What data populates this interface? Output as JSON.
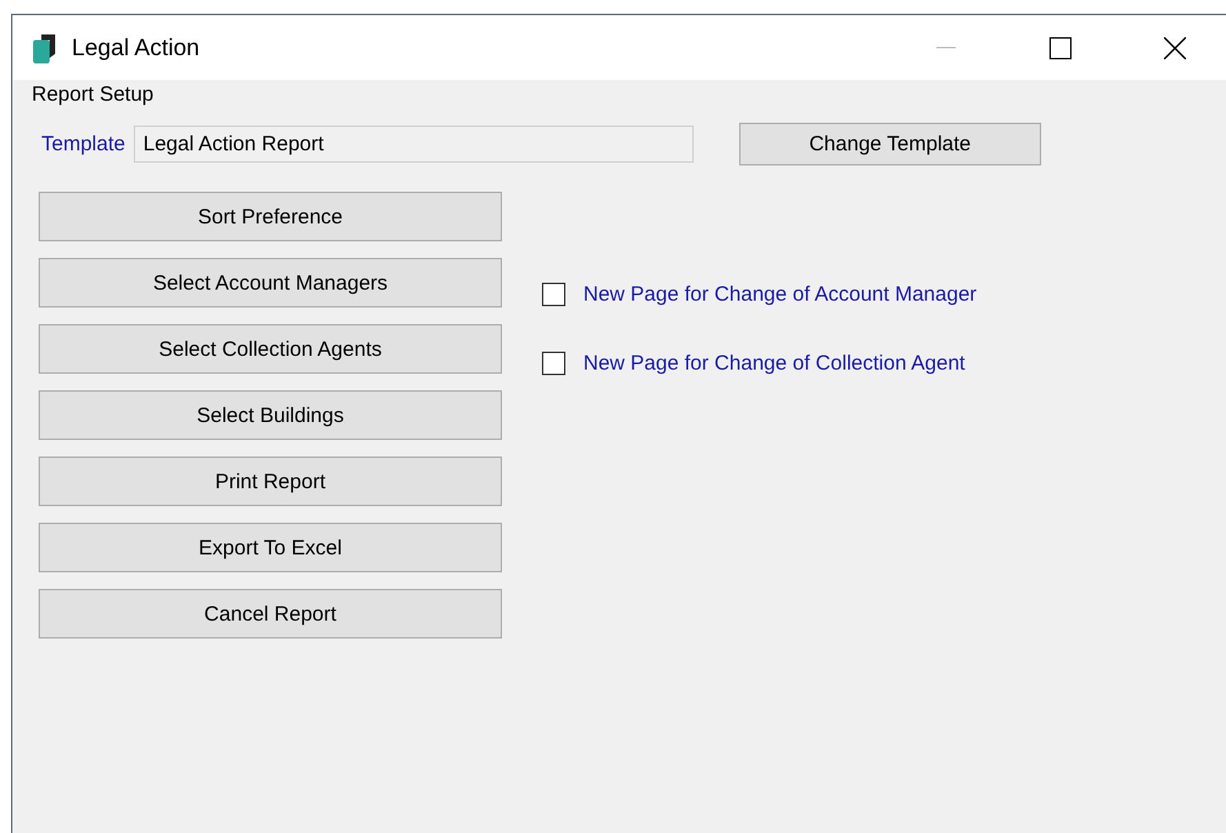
{
  "window": {
    "title": "Legal Action"
  },
  "group": {
    "title": "Report Setup"
  },
  "template": {
    "label": "Template",
    "value": "Legal Action Report"
  },
  "change_template_button": "Change Template",
  "buttons": [
    "Sort Preference",
    "Select Account Managers",
    "Select Collection Agents",
    "Select Buildings",
    "Print Report",
    "Export To Excel",
    "Cancel Report"
  ],
  "options": [
    {
      "label": "New Page for Change of Account Manager",
      "checked": false
    },
    {
      "label": "New Page for Change of Collection Agent",
      "checked": false
    }
  ]
}
